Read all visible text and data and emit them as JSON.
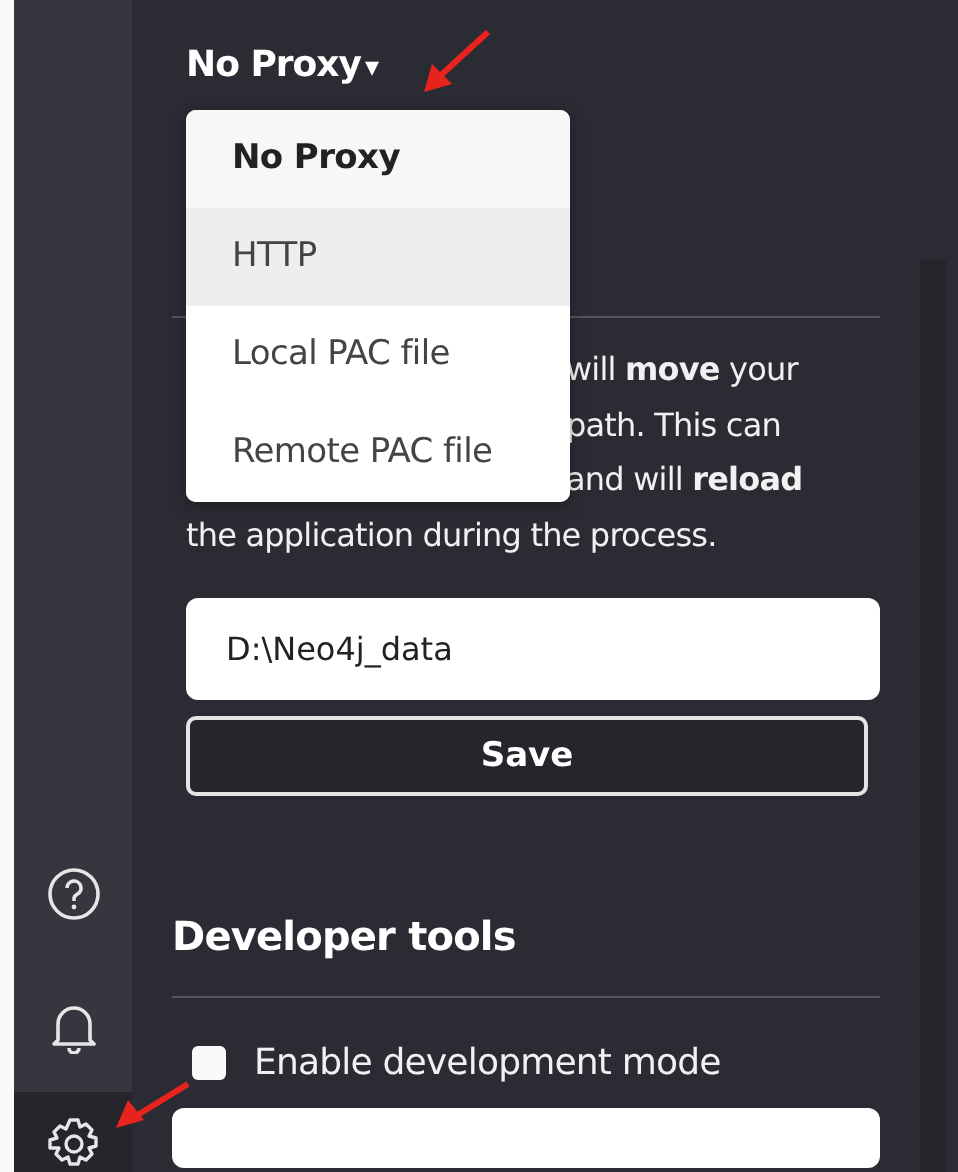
{
  "sidebar": {
    "items": [
      {
        "kind": "help",
        "selected": false
      },
      {
        "kind": "notifications",
        "selected": false
      },
      {
        "kind": "settings",
        "selected": true
      }
    ]
  },
  "proxy": {
    "value": "No Proxy",
    "caret": "▾",
    "expanded": true,
    "options": [
      {
        "label": "No Proxy",
        "selected": true,
        "highlighted": false
      },
      {
        "label": "HTTP",
        "selected": false,
        "highlighted": true
      },
      {
        "label": "Local PAC file",
        "selected": false,
        "highlighted": false
      },
      {
        "label": "Remote PAC file",
        "selected": false,
        "highlighted": false
      }
    ]
  },
  "data_path": {
    "description_lines": [
      "will **move** your",
      "path. This can",
      "and will **reload**",
      "the application during the process."
    ],
    "value": "D:\\Neo4j_data",
    "button": "Save"
  },
  "developer_tools": {
    "title": "Developer tools",
    "checkbox": {
      "label": "Enable development mode",
      "checked": false
    }
  }
}
